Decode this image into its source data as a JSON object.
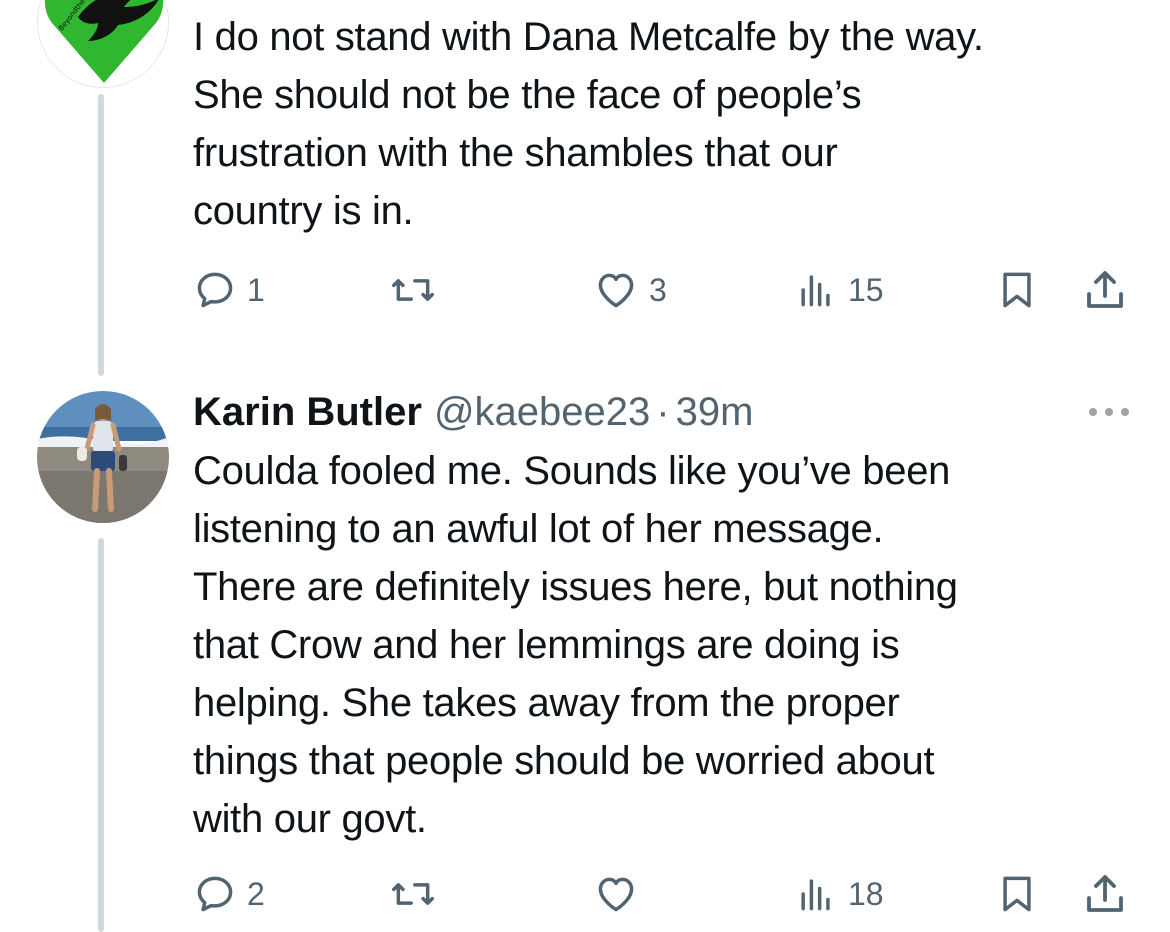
{
  "tweets": [
    {
      "text": "I do not stand with Dana Metcalfe by the way.\nShe should not be the face of people’s\nfrustration with the shambles that our\ncountry is in.",
      "actions": {
        "replies": "1",
        "retweets": "",
        "likes": "3",
        "views": "15"
      },
      "avatar": {
        "icon": "dove-on-green-heart-logo",
        "colors": {
          "heart": "#2fb82f",
          "dove": "#111111"
        }
      }
    },
    {
      "author": {
        "name": "Karin Butler",
        "handle": "@kaebee23"
      },
      "separator": "·",
      "time": "39m",
      "text": "Coulda fooled me. Sounds like you’ve been\nlistening to an awful lot of her message.\nThere are definitely issues here, but nothing\nthat Crow and her lemmings are doing is\nhelping. She takes away from the proper\nthings that people should be worried about\nwith our govt.",
      "actions": {
        "replies": "2",
        "retweets": "",
        "likes": "",
        "views": "18"
      },
      "avatar": {
        "icon": "beach-photo-avatar"
      }
    }
  ],
  "icons": {
    "reply": "reply-bubble-icon",
    "retweet": "retweet-icon",
    "like": "heart-icon",
    "views": "views-bar-chart-icon",
    "bookmark": "bookmark-icon",
    "share": "share-upload-icon",
    "more": "more-dots-icon"
  },
  "colors": {
    "text": "#0f1419",
    "secondary": "#536471",
    "thread_line": "#cfd9de"
  }
}
